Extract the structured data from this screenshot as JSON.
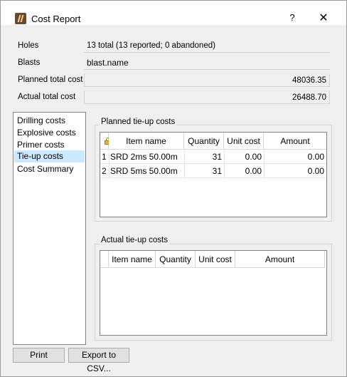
{
  "window": {
    "title": "Cost Report",
    "help_label": "?",
    "close_label": "✕"
  },
  "info": {
    "holes_label": "Holes",
    "holes_value": "13 total (13 reported; 0 abandoned)",
    "blasts_label": "Blasts",
    "blasts_value": "blast.name",
    "planned_label": "Planned total cost",
    "planned_value": "48036.35",
    "actual_label": "Actual total cost",
    "actual_value": "26488.70"
  },
  "nav": {
    "items": [
      {
        "label": "Drilling costs"
      },
      {
        "label": "Explosive costs"
      },
      {
        "label": "Primer costs"
      },
      {
        "label": "Tie-up costs"
      },
      {
        "label": "Cost Summary"
      }
    ],
    "selected": "Tie-up costs"
  },
  "planned": {
    "title": "Planned tie-up costs",
    "headers": [
      "Item name",
      "Quantity",
      "Unit cost",
      "Amount"
    ],
    "rows": [
      {
        "index": "1",
        "item": "SRD 2ms 50.00m",
        "quantity": "31",
        "unit_cost": "0.00",
        "amount": "0.00"
      },
      {
        "index": "2",
        "item": "SRD 5ms 50.00m",
        "quantity": "31",
        "unit_cost": "0.00",
        "amount": "0.00"
      }
    ]
  },
  "actual": {
    "title": "Actual tie-up costs",
    "headers": [
      "Item name",
      "Quantity",
      "Unit cost",
      "Amount"
    ]
  },
  "buttons": {
    "print": "Print",
    "export": "Export to CSV..."
  },
  "icons": {
    "app": "app-logo-icon",
    "lock": "lock-icon",
    "help": "help-icon",
    "close": "close-icon"
  }
}
